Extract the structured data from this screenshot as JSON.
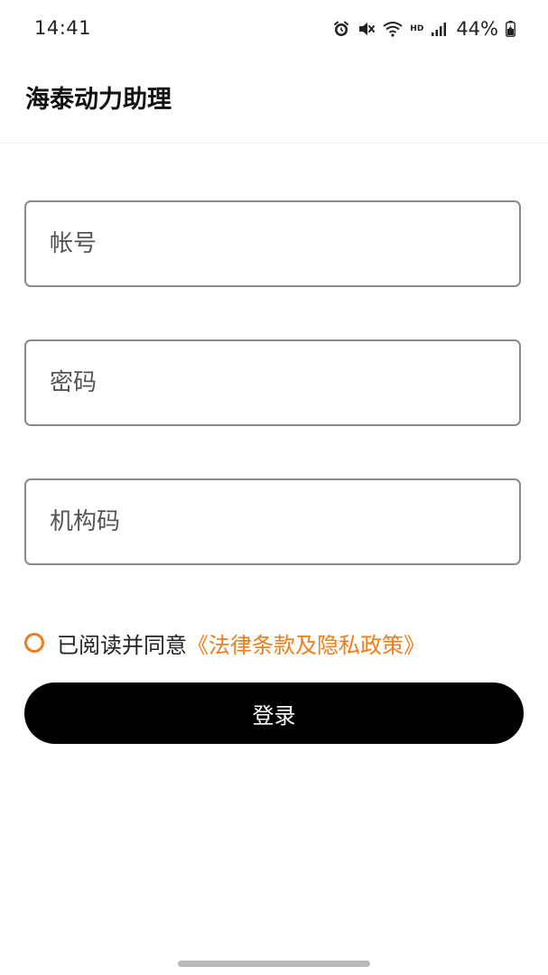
{
  "status_bar": {
    "time": "14:41",
    "battery_percent": "44%",
    "network_label": "HD",
    "icons": [
      "alarm-icon",
      "mute-icon",
      "wifi-icon",
      "signal-icon",
      "battery-charging-icon"
    ]
  },
  "header": {
    "title": "海泰动力助理"
  },
  "form": {
    "account_placeholder": "帐号",
    "password_placeholder": "密码",
    "org_code_placeholder": "机构码"
  },
  "agreement": {
    "text": "已阅读并同意",
    "link": "《法律条款及隐私政策》"
  },
  "login": {
    "label": "登录"
  },
  "colors": {
    "accent": "#f07d18",
    "button_bg": "#000000",
    "border": "#8a8a8a"
  }
}
